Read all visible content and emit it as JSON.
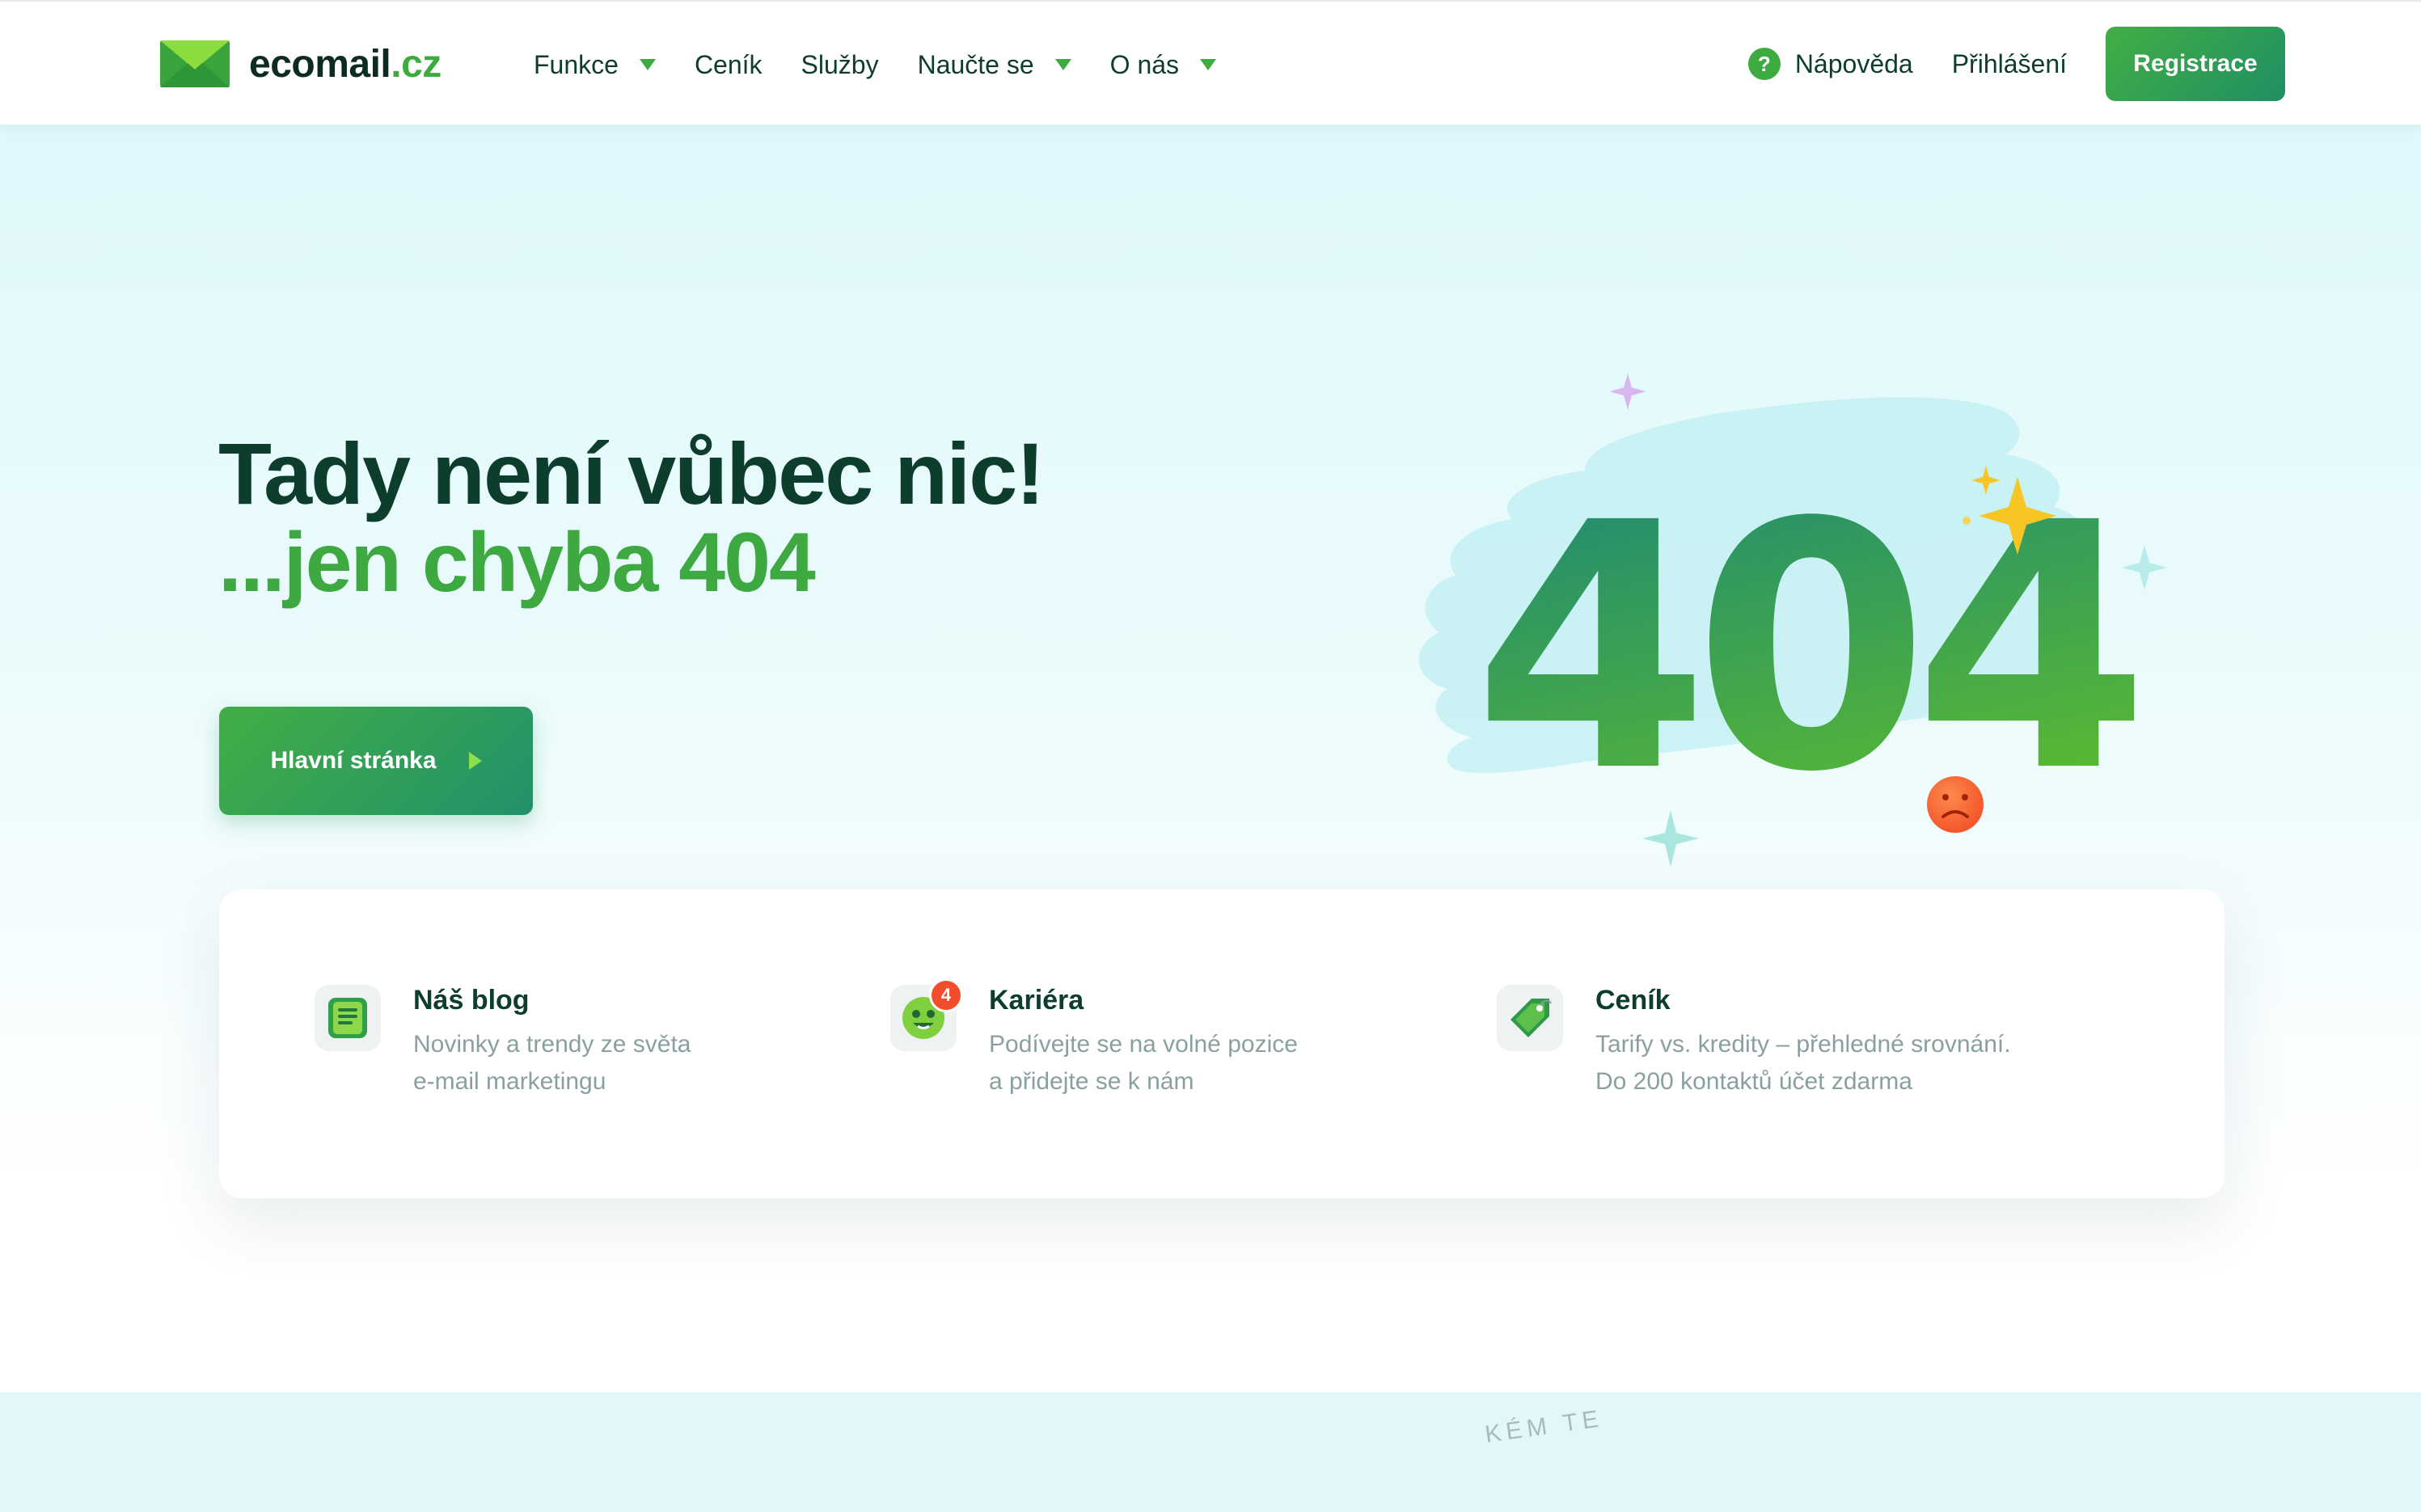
{
  "header": {
    "logo": {
      "name": "ecomail",
      "tld": ".cz"
    },
    "nav": [
      {
        "label": "Funkce",
        "dropdown": true
      },
      {
        "label": "Ceník",
        "dropdown": false
      },
      {
        "label": "Služby",
        "dropdown": false
      },
      {
        "label": "Naučte se",
        "dropdown": true
      },
      {
        "label": "O nás",
        "dropdown": true
      }
    ],
    "help_label": "Nápověda",
    "login_label": "Přihlášení",
    "register_label": "Registrace"
  },
  "hero": {
    "title": "Tady není vůbec nic!",
    "subtitle": "...jen chyba 404",
    "cta_label": "Hlavní stránka",
    "error_code": "404"
  },
  "cards": [
    {
      "title": "Náš blog",
      "desc_line1": "Novinky a trendy ze světa",
      "desc_line2": "e-mail marketingu",
      "icon": "blog-icon"
    },
    {
      "title": "Kariéra",
      "desc_line1": "Podívejte se na volné pozice",
      "desc_line2": "a přidejte se k nám",
      "icon": "career-smiley-icon",
      "badge": "4"
    },
    {
      "title": "Ceník",
      "desc_line1": "Tarify vs. kredity – přehledné srovnání.",
      "desc_line2": "Do 200 kontaktů účet zdarma",
      "icon": "price-tag-icon"
    }
  ],
  "footer_strip": {
    "curved_text": "KÉM TE"
  },
  "colors": {
    "brand_green": "#3dab3f",
    "dark_text": "#0d3d2c",
    "teal": "#1f8a7a",
    "muted_text": "#8aa0a0",
    "sad_face": "#f25c2a"
  }
}
